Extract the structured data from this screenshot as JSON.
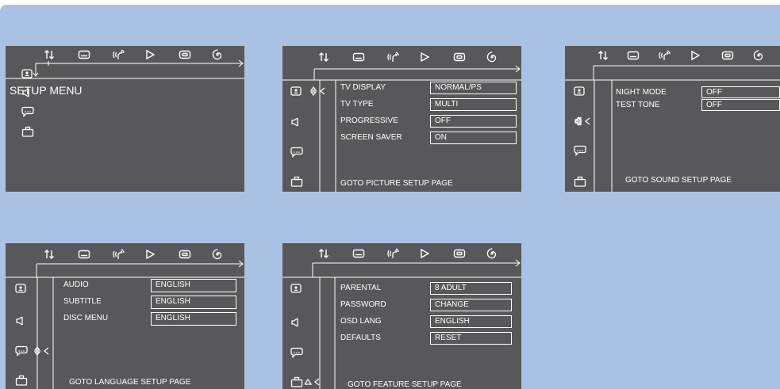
{
  "icons": [
    "audio-subtitle-toggle-icon",
    "subtitle-icon",
    "audio-icon",
    "play-icon",
    "dvd-icon",
    "repeat-icon"
  ],
  "side_icons": [
    "picture-icon",
    "speaker-icon",
    "language-icon",
    "feature-icon"
  ],
  "main_menu": {
    "title": "SETUP MENU"
  },
  "picture_page": {
    "rows": [
      {
        "label": "TV DISPLAY",
        "value": "NORMAL/PS"
      },
      {
        "label": "TV TYPE",
        "value": "MULTI"
      },
      {
        "label": "PROGRESSIVE",
        "value": "OFF"
      },
      {
        "label": "SCREEN SAVER",
        "value": "ON"
      }
    ],
    "goto": "GOTO PICTURE SETUP PAGE"
  },
  "sound_page": {
    "rows": [
      {
        "label": "NIGHT MODE",
        "value": "OFF"
      },
      {
        "label": "TEST TONE",
        "value": "OFF"
      }
    ],
    "goto": "GOTO SOUND SETUP PAGE"
  },
  "language_page": {
    "rows": [
      {
        "label": "AUDIO",
        "value": "ENGLISH"
      },
      {
        "label": "SUBTITLE",
        "value": "ENGLISH"
      },
      {
        "label": "DISC MENU",
        "value": "ENGLISH"
      }
    ],
    "goto": "GOTO LANGUAGE SETUP PAGE"
  },
  "feature_page": {
    "rows": [
      {
        "label": "PARENTAL",
        "value": "8 ADULT"
      },
      {
        "label": "PASSWORD",
        "value": "CHANGE"
      },
      {
        "label": "OSD LANG",
        "value": "ENGLISH"
      },
      {
        "label": "DEFAULTS",
        "value": "RESET"
      }
    ],
    "goto": "GOTO FEATURE SETUP PAGE"
  }
}
